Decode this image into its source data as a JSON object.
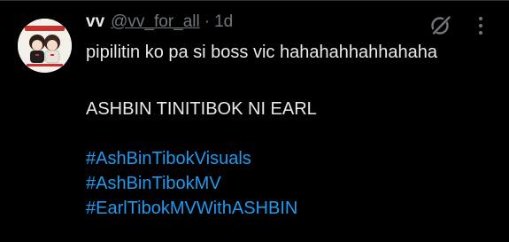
{
  "post": {
    "author": {
      "display_name": "vv",
      "handle": "@vv_for_all",
      "separator": "·",
      "time": "1d",
      "avatar_icon": "avatar-illustration"
    },
    "actions": {
      "grok_icon": "grok-icon",
      "more_icon": "more-icon"
    },
    "text": {
      "line1": "pipilitin ko pa si boss vic hahahahhahhahaha",
      "line2": "ASHBIN TINITIBOK NI EARL"
    },
    "hashtags": [
      "#AshBinTibokVisuals",
      "#AshBinTibokMV",
      "#EarlTibokMVWithASHBIN"
    ]
  },
  "colors": {
    "background": "#000000",
    "text": "#e7e9ea",
    "muted": "#71767b",
    "link": "#1d9bf0"
  }
}
